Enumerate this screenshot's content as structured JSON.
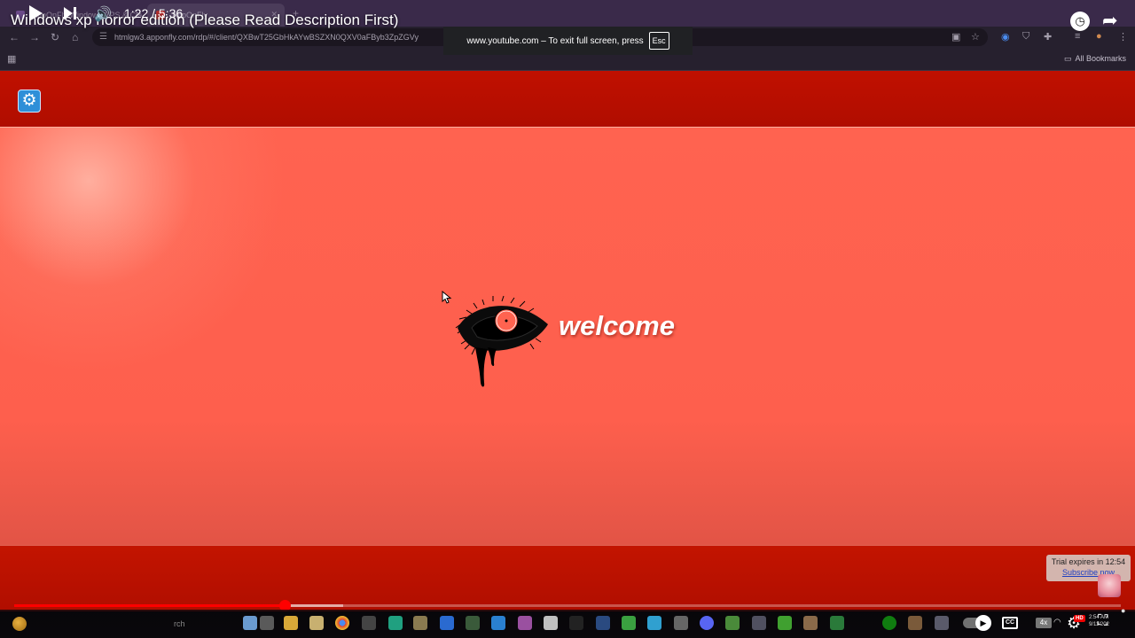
{
  "browser": {
    "tabs": [
      {
        "label": "AppOnFly Windows VPS & Clo"
      },
      {
        "label": "AppOnFly"
      }
    ],
    "new_tab_label": "+",
    "url": "htmlgw3.apponfly.com/rdp/#/client/QXBwT25GbHkAYwBSZXN0QXV0aFByb3ZpZGVy",
    "all_bookmarks_label": "All Bookmarks"
  },
  "youtube": {
    "title": "Windows xp horror edition (Please Read Description First)",
    "current_time": "1:22",
    "duration": "5:36",
    "time_separator": " / ",
    "progress_fraction": 0.244,
    "buffered_fraction": 0.297,
    "fullscreen_notice": "www.youtube.com – To exit full screen, press",
    "esc_key_label": "Esc",
    "cc_label": "CC",
    "speed_label": "4x",
    "hd_label": "HD"
  },
  "remote_desktop": {
    "welcome_text": "welcome",
    "trial_text": "Trial expires in 12:54",
    "subscribe_link": "Subscribe now",
    "taskbar_search_label": "rch",
    "clock_time": "2:54 AM",
    "clock_date": "9/11/202"
  },
  "colors": {
    "top_bar": "#b00d00",
    "desktop": "#ff6350",
    "progress": "#ff0000"
  },
  "icons": {
    "settings": "gear-icon",
    "eye_logo": "bleeding-eye-icon",
    "play": "play-icon",
    "next": "skip-next-icon",
    "volume": "volume-icon"
  }
}
